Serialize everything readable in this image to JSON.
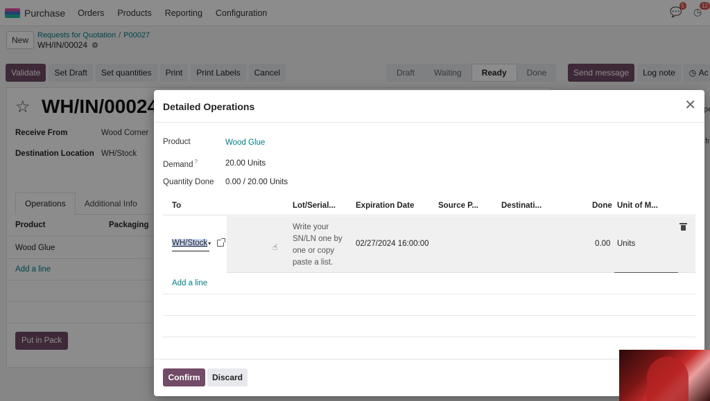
{
  "nav": {
    "app_name": "Purchase",
    "menu": [
      "Orders",
      "Products",
      "Reporting",
      "Configuration"
    ],
    "chat_badge": "5",
    "activity_badge": "12"
  },
  "control": {
    "new_label": "New",
    "breadcrumb_parent": "Requests for Quotation",
    "breadcrumb_sep": "/",
    "breadcrumb_current": "P00027",
    "record_name": "WH/IN/00024"
  },
  "toolbar": {
    "validate": "Validate",
    "set_draft": "Set Draft",
    "set_quantities": "Set quantities",
    "print": "Print",
    "print_labels": "Print Labels",
    "cancel": "Cancel"
  },
  "status": {
    "stages": [
      "Draft",
      "Waiting",
      "Ready",
      "Done"
    ],
    "current": "Ready"
  },
  "chatter": {
    "send_message": "Send message",
    "log_note": "Log note",
    "activities_partial": "Ac"
  },
  "form": {
    "title": "WH/IN/00024",
    "receive_from_label": "Receive From",
    "receive_from_value": "Wood Corner",
    "dest_label": "Destination Location",
    "dest_value": "WH/Stock",
    "tabs": [
      "Operations",
      "Additional Info"
    ],
    "col_product": "Product",
    "col_packaging": "Packaging",
    "row_product": "Wood Glue",
    "add_line": "Add a line",
    "put_in_pack": "Put in Pack",
    "side_text_1": "pe",
    "side_text_2": "fr"
  },
  "modal": {
    "title": "Detailed Operations",
    "product_label": "Product",
    "product_value": "Wood Glue",
    "demand_label": "Demand",
    "demand_help": "?",
    "demand_value": "20.00 Units",
    "qty_done_label": "Quantity Done",
    "qty_done_value": "0.00 / 20.00 Units",
    "columns": {
      "to": "To",
      "lot": "Lot/Serial...",
      "expiration": "Expiration Date",
      "source": "Source P...",
      "destination": "Destinati...",
      "done": "Done",
      "uom": "Unit of M..."
    },
    "row": {
      "to": "WH/Stock",
      "lot_placeholder": "Write your SN/LN one by one or copy paste a list.",
      "expiration": "02/27/2024 16:00:00",
      "done": "0.00",
      "uom": "Units"
    },
    "add_line": "Add a line",
    "confirm": "Confirm",
    "discard": "Discard"
  }
}
